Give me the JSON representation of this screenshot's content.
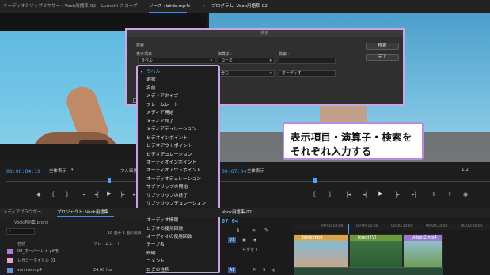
{
  "tabs": {
    "audio_mixer": "オーディオクリップミキサー : Vook用語集-02",
    "lumetri": "Lumetri スコープ",
    "source": "ソース : birds.mp4",
    "program": "プログラム: Vook用語集-02"
  },
  "source_monitor": {
    "timecode": "00:00:04:19",
    "view": "全体表示",
    "full_quality": "フル画質"
  },
  "program_monitor": {
    "timecode": "00:07:04",
    "view": "全体表示",
    "fraction": "1/2"
  },
  "dialog": {
    "title": "検索",
    "section_label": "検索 :",
    "col_display": "表示項目 :",
    "col_operator": "演算子 :",
    "col_search": "検索 :",
    "operator_value": "コーズ",
    "operator_value2": "含む",
    "search_value": "オーディオ",
    "search_button": "検索",
    "done_button": "完了"
  },
  "display_select": {
    "value": "ラベル"
  },
  "menu": {
    "items": [
      "ラベル",
      "選択",
      "名前",
      "メディアタイプ",
      "フレームレート",
      "メディア開始",
      "メディア終了",
      "メディアデュレーション",
      "ビデオインポイント",
      "ビデオアウトポイント",
      "ビデオデュレーション",
      "オーディオインポイント",
      "オーディオアウトポイント",
      "オーディオデュレーション",
      "サブクリップの開始",
      "サブクリップの終了",
      "サブクリップデュレーション",
      "ビデオ情報",
      "オーディオ情報",
      "ビデオの使用回数",
      "オーディオの使用回数",
      "テープ名",
      "説明",
      "コメント",
      "ログの注釈"
    ],
    "selected_index": 0
  },
  "callout": {
    "line1": "表示項目・演算子・検索を",
    "line2": "それぞれ入力する"
  },
  "project_panel": {
    "tab_media_browser": "メディアブラウザー",
    "tab_project": "プロジェクト: Vook用語集",
    "file": "Vook用語集.prproj",
    "count": "16 個中 1 個の項目",
    "col_name": "名前",
    "col_framerate": "フレームレート",
    "rows": [
      {
        "name": "08_オーバーレイ gif用",
        "rate": "",
        "color": "#b07ad9"
      },
      {
        "name": "レガシータイトル 01",
        "rate": "",
        "color": "#e9a1c8"
      },
      {
        "name": "sunrise.mp4",
        "rate": "24.00 fps",
        "color": "#6a8fe0"
      }
    ]
  },
  "timeline": {
    "tab": "Vook用語集-02",
    "timecode": "07:04",
    "track_label": "ビデオ 1",
    "clips": [
      {
        "name": "birds.mp4"
      },
      {
        "name": "forest [V]"
      },
      {
        "name": "video-2.mp4"
      }
    ],
    "ruler": [
      "00:00:10:00",
      "00:00:15:00",
      "00:00:20:00",
      "00:00:25:00",
      "00:00:30:00"
    ]
  }
}
